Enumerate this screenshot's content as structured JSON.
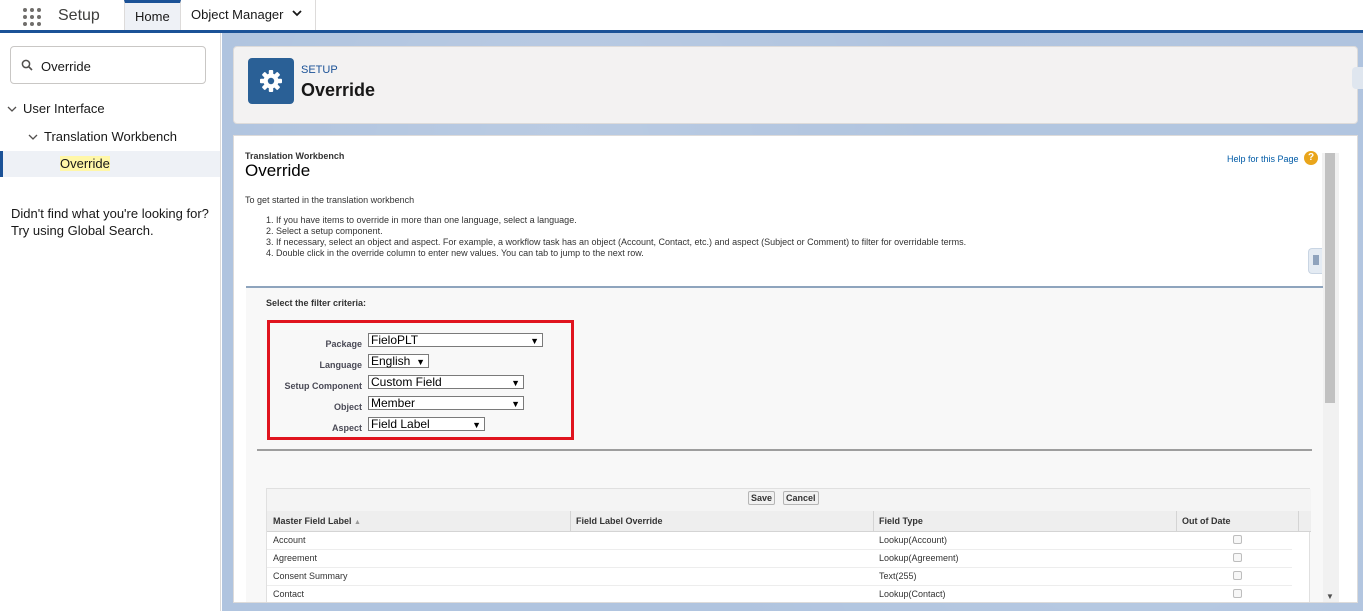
{
  "topbar": {
    "app_name": "Setup",
    "tabs": [
      {
        "label": "Home"
      },
      {
        "label": "Object Manager"
      }
    ]
  },
  "sidebar": {
    "search_value": "Override",
    "tree": [
      {
        "label": "User Interface"
      },
      {
        "label": "Translation Workbench"
      },
      {
        "label": "Override"
      }
    ],
    "not_found_line1": "Didn't find what you're looking for?",
    "not_found_line2": "Try using Global Search."
  },
  "header": {
    "breadcrumb": "SETUP",
    "title": "Override"
  },
  "page": {
    "breadcrumb": "Translation Workbench",
    "title": "Override",
    "help_link": "Help for this Page",
    "help_icon_glyph": "?",
    "intro": "To get started in the translation workbench",
    "steps": [
      "1. If you have items to override in more than one language, select a language.",
      "2. Select a setup component.",
      "3. If necessary, select an object and aspect. For example, a workflow task has an object (Account, Contact, etc.) and aspect (Subject or Comment) to filter for overridable terms.",
      "4. Double click in the override column to enter new values. You can tab to jump to the next row."
    ]
  },
  "filter": {
    "heading": "Select the filter criteria:",
    "fields": [
      {
        "label": "Package",
        "value": "FieloPLT"
      },
      {
        "label": "Language",
        "value": "English"
      },
      {
        "label": "Setup Component",
        "value": "Custom Field"
      },
      {
        "label": "Object",
        "value": "Member"
      },
      {
        "label": "Aspect",
        "value": "Field Label"
      }
    ],
    "highlight_color": "#e0141e"
  },
  "grid": {
    "save_label": "Save",
    "cancel_label": "Cancel",
    "columns": [
      "Master Field Label",
      "Field Label Override",
      "Field Type",
      "Out of Date"
    ],
    "sort_indicator": "▲",
    "rows": [
      {
        "label": "Account",
        "override": "",
        "type": "Lookup(Account)",
        "out_of_date": false
      },
      {
        "label": "Agreement",
        "override": "",
        "type": "Lookup(Agreement)",
        "out_of_date": false
      },
      {
        "label": "Consent Summary",
        "override": "",
        "type": "Text(255)",
        "out_of_date": false
      },
      {
        "label": "Contact",
        "override": "",
        "type": "Lookup(Contact)",
        "out_of_date": false
      }
    ]
  },
  "colors": {
    "brand": "#1b5297",
    "header_icon": "#2a6096",
    "main_bg": "#b0c4df"
  },
  "icons": {
    "apps": "app-launcher-icon",
    "search": "search-icon",
    "gear": "gear-icon",
    "help": "help-icon"
  }
}
